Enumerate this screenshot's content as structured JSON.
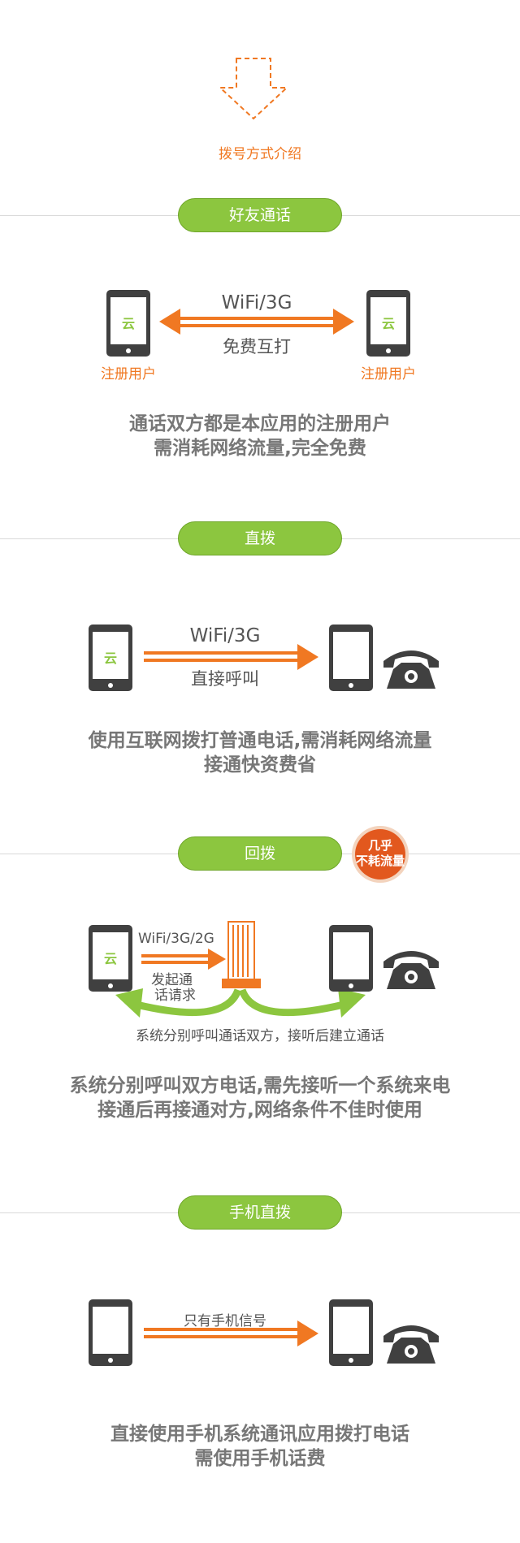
{
  "header": {
    "intro_label": "拨号方式介绍"
  },
  "sections": [
    {
      "title": "好友通话",
      "network": "WiFi/3G",
      "action": "免费互打",
      "left_user": "注册用户",
      "right_user": "注册用户",
      "phone_logo": "云",
      "desc_line1": "通话双方都是本应用的注册用户",
      "desc_line2": "需消耗网络流量,完全免费"
    },
    {
      "title": "直拨",
      "network": "WiFi/3G",
      "action": "直接呼叫",
      "phone_logo": "云",
      "desc_line1": "使用互联网拨打普通电话,需消耗网络流量",
      "desc_line2": "接通快资费省"
    },
    {
      "title": "回拨",
      "badge_line1": "几乎",
      "badge_line2": "不耗流量",
      "network": "WiFi/3G/2G",
      "request_line1": "发起通",
      "request_line2": "话请求",
      "system_note": "系统分别呼叫通话双方，接听后建立通话",
      "phone_logo": "云",
      "desc_line1": "系统分别呼叫双方电话,需先接听一个系统来电",
      "desc_line2": "接通后再接通对方,网络条件不佳时使用"
    },
    {
      "title": "手机直拨",
      "signal": "只有手机信号",
      "desc_line1": "直接使用手机系统通讯应用拨打电话",
      "desc_line2": "需使用手机话费"
    }
  ],
  "icons": {
    "down_arrow": "dashed-down-arrow-icon",
    "smartphone": "smartphone-icon",
    "desk_phone": "telephone-icon",
    "server": "server-icon"
  },
  "colors": {
    "accent_orange": "#f07822",
    "accent_green": "#8cc63f",
    "phone_dark": "#404040",
    "text_gray": "#777777"
  }
}
